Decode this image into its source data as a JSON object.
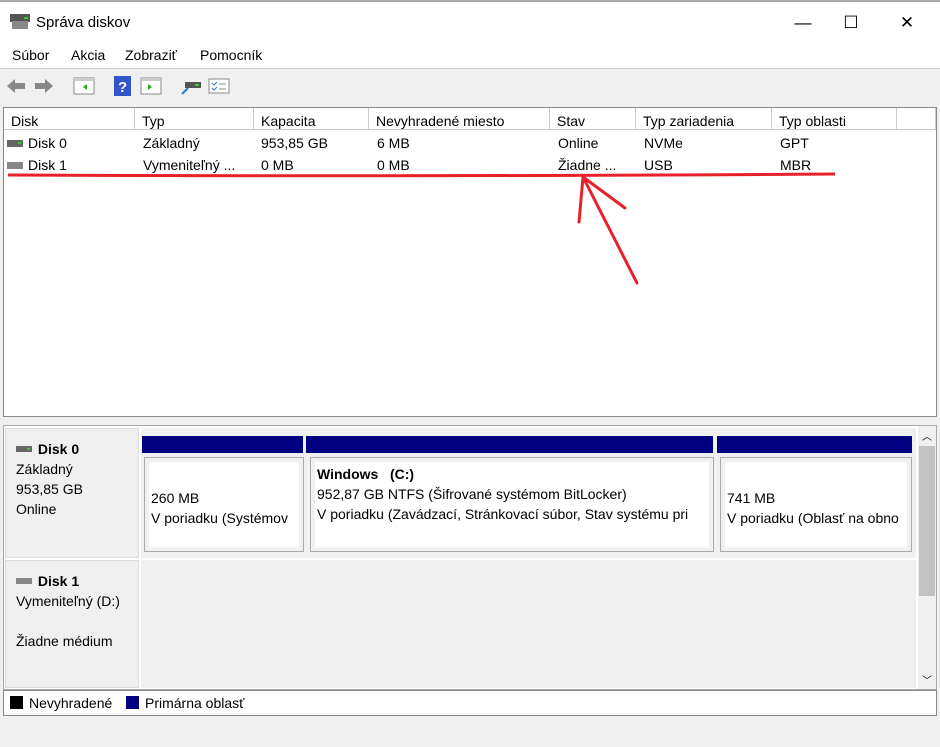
{
  "window": {
    "title": "Správa diskov",
    "minimize": "—",
    "maximize": "☐",
    "close": "✕"
  },
  "menu": [
    "Súbor",
    "Akcia",
    "Zobraziť",
    "Pomocník"
  ],
  "toolbar": [
    "back-icon",
    "forward-icon",
    "show-hide-console-tree-icon",
    "help-icon",
    "show-hide-action-pane-icon",
    "connect-disk-icon",
    "properties-icon"
  ],
  "list": {
    "columns": [
      "Disk",
      "Typ",
      "Kapacita",
      "Nevyhradené miesto",
      "Stav",
      "Typ zariadenia",
      "Typ oblasti"
    ],
    "rows": [
      [
        "Disk 0",
        "Základný",
        "953,85 GB",
        "6 MB",
        "Online",
        "NVMe",
        "GPT"
      ],
      [
        "Disk 1",
        "Vymeniteľný ...",
        "0 MB",
        "0 MB",
        "Žiadne ...",
        "USB",
        "MBR"
      ]
    ]
  },
  "graph": {
    "disk0": {
      "name": "Disk 0",
      "type": "Základný",
      "size": "953,85 GB",
      "status": "Online",
      "partitions": [
        {
          "title": "",
          "size": "260 MB",
          "status": "V poriadku (Systémov"
        },
        {
          "title": "Windows   (C:)",
          "size": "952,87 GB NTFS (Šifrované systémom BitLocker)",
          "status": "V poriadku (Zavádzací, Stránkovací súbor, Stav systému pri"
        },
        {
          "title": "",
          "size": "741 MB",
          "status": "V poriadku (Oblasť na obno"
        }
      ]
    },
    "disk1": {
      "name": "Disk 1",
      "type": "Vymeniteľný (D:)",
      "status": "Žiadne médium"
    }
  },
  "legend": [
    {
      "label": "Nevyhradené",
      "color": "#000000"
    },
    {
      "label": "Primárna oblasť",
      "color": "#000080"
    }
  ],
  "colors": {
    "annotation": "#e8202a",
    "primary": "#000080"
  }
}
